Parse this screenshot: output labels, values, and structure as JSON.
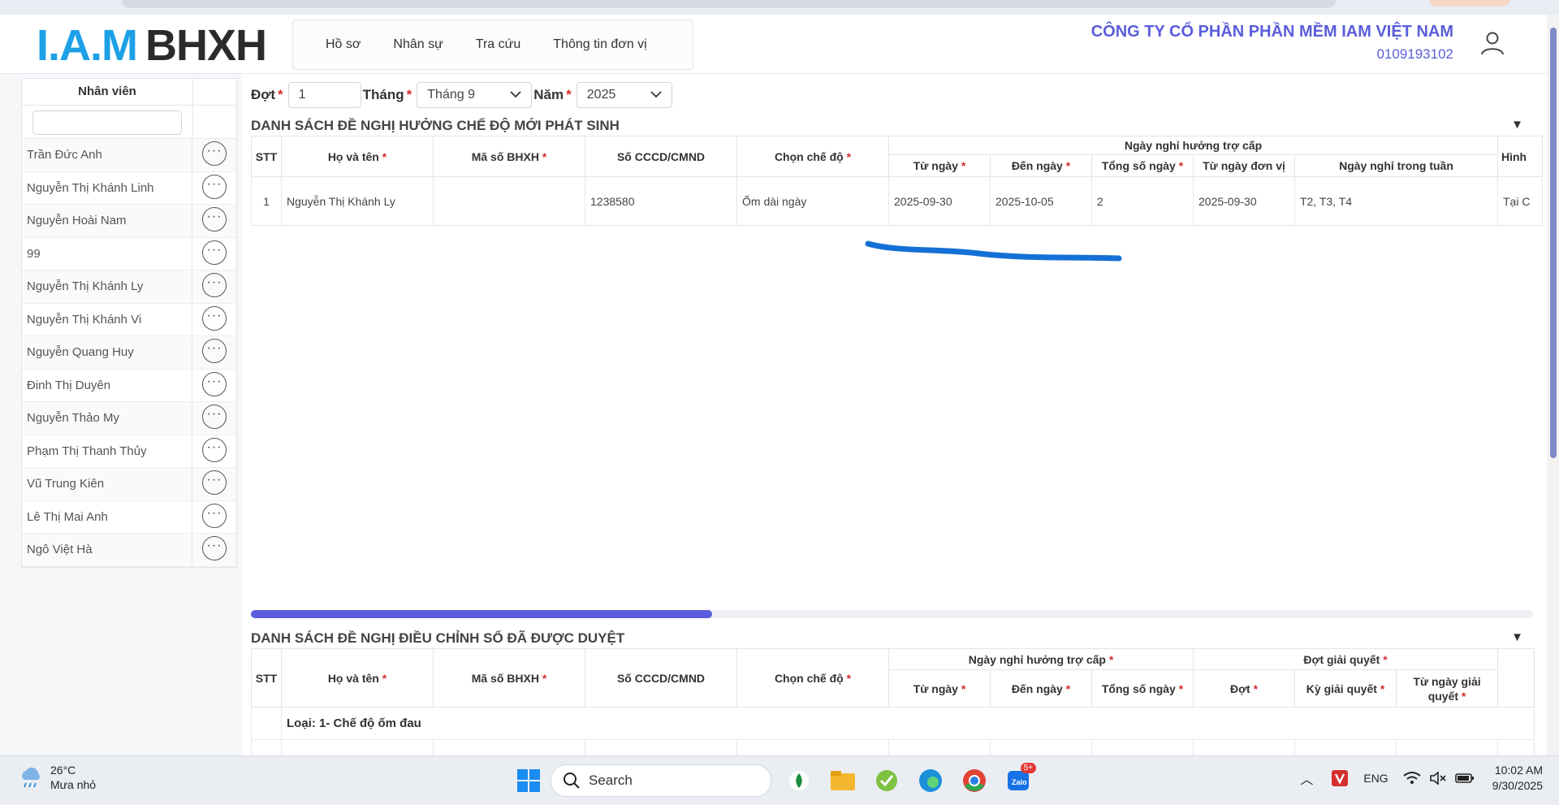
{
  "header": {
    "logo_iam": "I.A.M",
    "logo_bhxh": "BHXH",
    "nav": [
      "Hồ sơ",
      "Nhân sự",
      "Tra cứu",
      "Thông tin đơn vị"
    ],
    "company_name": "CÔNG TY CỔ PHẦN PHẦN MỀM IAM VIỆT NAM",
    "tax_code": "0109193102"
  },
  "employees": {
    "header": "Nhân viên",
    "filter_value": "",
    "items": [
      "Trần Đức Anh",
      "Nguyễn Thị Khánh Linh",
      "Nguyễn Hoài Nam",
      "99",
      "Nguyễn Thị Khánh Ly",
      "Nguyễn Thị Khánh Vi",
      "Nguyễn Quang Huy",
      "Đinh Thị Duyên",
      "Nguyễn Thảo My",
      "Phạm Thị Thanh Thủy",
      "Vũ Trung Kiên",
      "Lê Thị Mai Anh",
      "Ngô Việt Hà"
    ],
    "more_glyph": "···"
  },
  "filters": {
    "dot_label": "Đợt",
    "dot_value": "1",
    "thang_label": "Tháng",
    "thang_value": "Tháng 9",
    "nam_label": "Năm",
    "nam_value": "2025",
    "required_mark": "*"
  },
  "section1": {
    "title": "DANH SÁCH ĐỀ NGHỊ HƯỞNG CHẾ ĐỘ MỚI PHÁT SINH",
    "collapse_glyph": "▼",
    "headers": {
      "stt": "STT",
      "ho_ten": "Họ và tên",
      "ma_so": "Mã số BHXH",
      "cccd": "Số CCCD/CMND",
      "che_do": "Chọn chế độ",
      "group": "Ngày nghỉ hưởng trợ cấp",
      "tu_ngay": "Từ ngày",
      "den_ngay": "Đến ngày",
      "tong_so": "Tổng số ngày",
      "tu_ngay_dv": "Từ ngày đơn vị",
      "trong_tuan": "Ngày nghỉ trong tuần",
      "hinh": "Hình"
    },
    "row": {
      "stt": "1",
      "ho_ten": "Nguyễn Thị Khánh Ly",
      "ma_so": "",
      "cccd": "1238580",
      "che_do": "Ốm dài ngày",
      "tu_ngay": "2025-09-30",
      "den_ngay": "2025-10-05",
      "tong_so": "2",
      "tu_ngay_dv": "2025-09-30",
      "trong_tuan": "T2, T3, T4",
      "hinh": "Tại C"
    },
    "scroll_fraction": 0.36
  },
  "section2": {
    "title": "DANH SÁCH ĐỀ NGHỊ ĐIỀU CHỈNH SỐ ĐÃ ĐƯỢC DUYỆT",
    "collapse_glyph": "▼",
    "headers": {
      "stt": "STT",
      "ho_ten": "Họ và tên",
      "ma_so": "Mã số BHXH",
      "cccd": "Số CCCD/CMND",
      "che_do": "Chọn chế độ",
      "group1": "Ngày nghỉ hưởng trợ cấp",
      "group2": "Đợt giải quyết",
      "tu_ngay": "Từ ngày",
      "den_ngay": "Đến ngày",
      "tong_so": "Tổng số ngày",
      "dot": "Đợt",
      "ky": "Kỳ giải quyết",
      "tu_ngay_gq": "Từ ngày giải quyết"
    },
    "group_row": "Loại: 1- Chế độ ốm đau"
  },
  "taskbar": {
    "temp": "26°C",
    "weather": "Mưa nhỏ",
    "search": "Search",
    "badge": "5+",
    "lang": "ENG",
    "time": "10:02 AM",
    "date": "9/30/2025"
  },
  "colors": {
    "accent": "#5a5ddb",
    "logo_blue": "#1da0e6",
    "required": "#d32f2f",
    "annotation": "#1570d6"
  }
}
